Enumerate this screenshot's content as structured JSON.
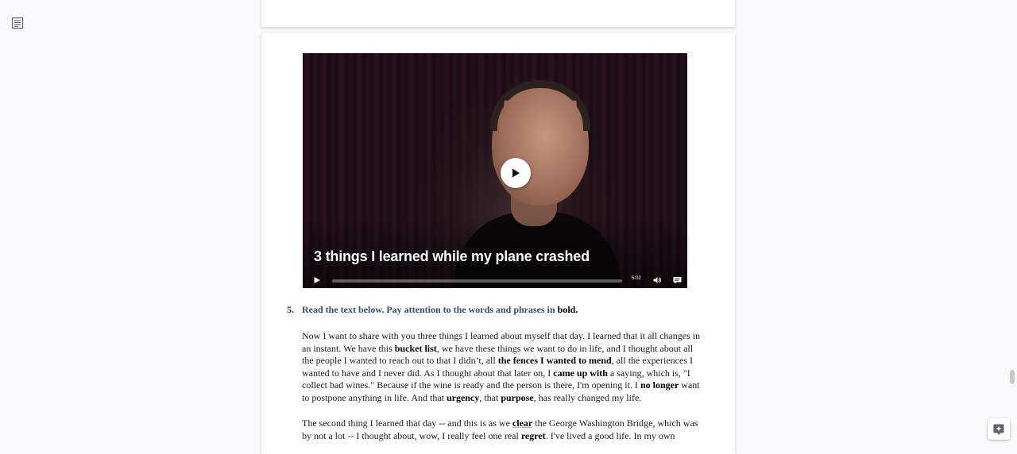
{
  "video": {
    "title": "3 things I learned while my plane crashed",
    "time": "5:02",
    "progress_fraction": 0.0
  },
  "question": {
    "number": "5.",
    "instruction_prefix": "Read the text below. Pay attention to the words and phrases in ",
    "instruction_emph": "bold."
  },
  "paragraph1": {
    "t1": "Now I want to share with you three things I learned about myself that day. I learned that it all changes in an instant. We have this ",
    "b1": "bucket list",
    "t2": ", we have these things we want to do in life, and I thought about all the people I wanted to reach out to that I didn’t, all ",
    "b2": "the fences I wanted to mend",
    "t3": ", all the experiences I wanted to have and I never did. As I thought about that later on, I ",
    "b3": "came up with",
    "t4": " a saying, which is, \"I collect bad wines.\" Because if the wine is ready and the person is there, I'm opening it. I ",
    "b4": "no longer",
    "t5": " want to postpone anything in life. And that ",
    "b5": "urgency",
    "t6": ", that ",
    "b6": "purpose",
    "t7": ", has really changed my life."
  },
  "paragraph2": {
    "t1": "The second thing I learned that day -- and this is as we ",
    "b1": "clear",
    "t2": " the George Washington Bridge, which was by not a lot -- I thought about, wow, I really feel one real ",
    "b2": "regret",
    "t3": ". I've lived a good life. In my own"
  }
}
